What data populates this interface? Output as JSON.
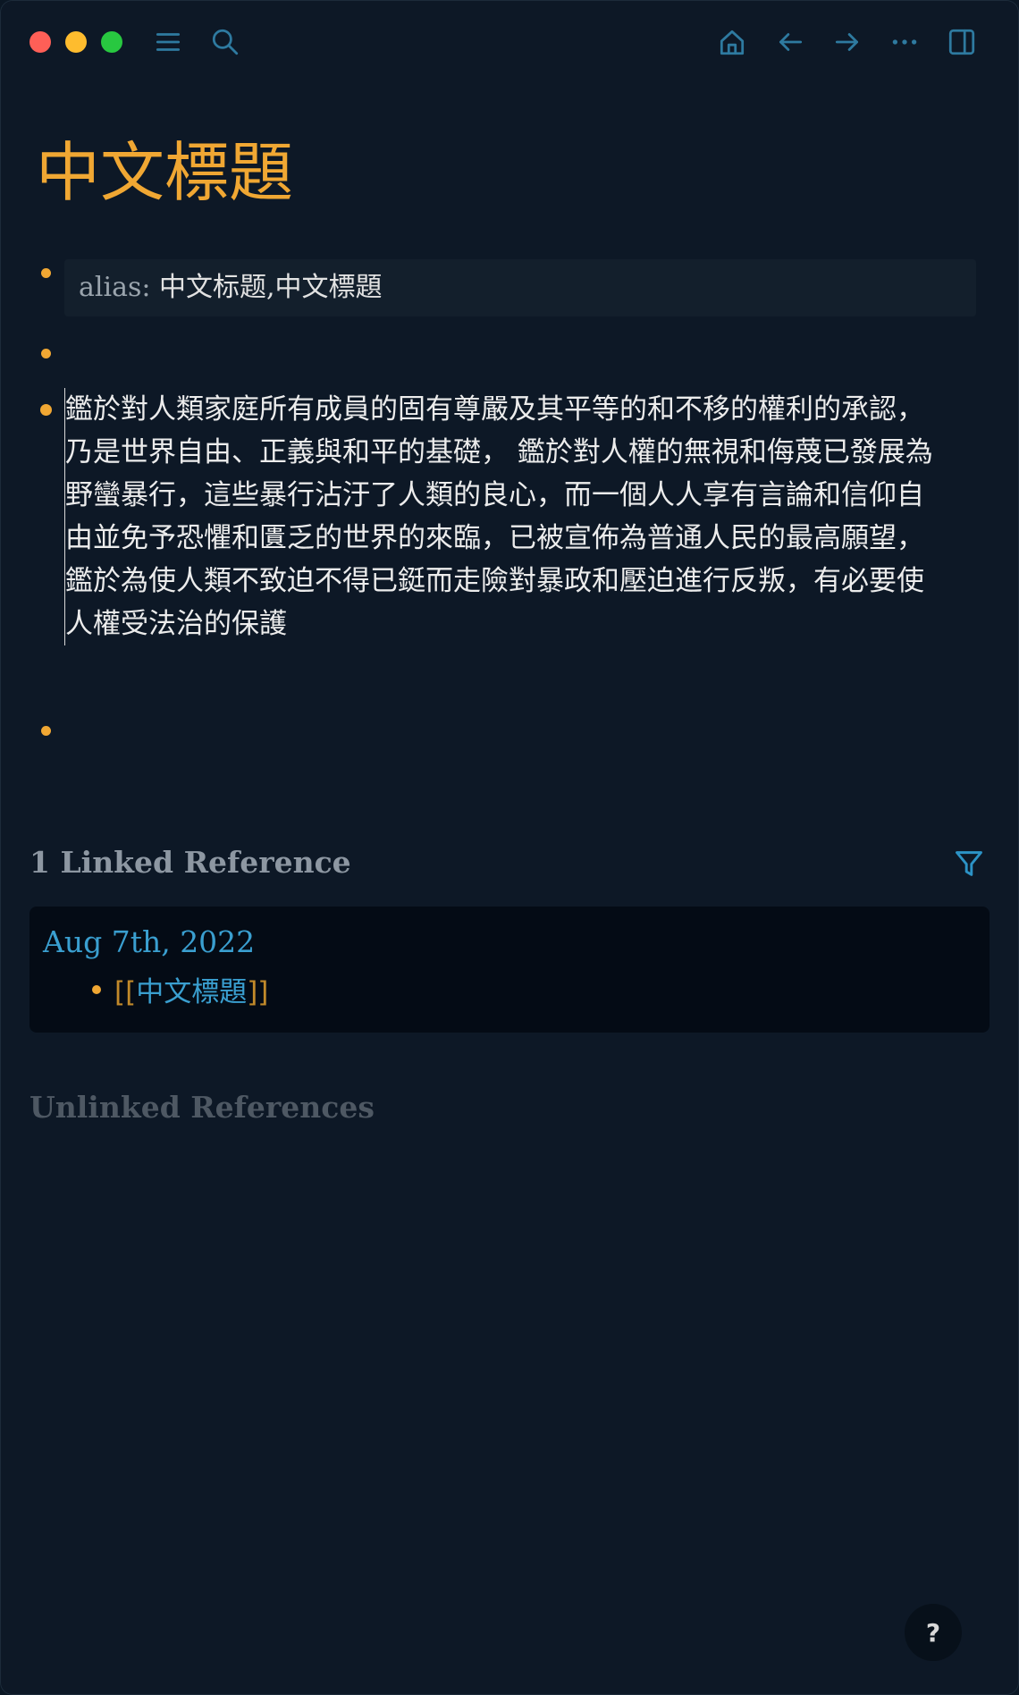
{
  "toolbar": {
    "icons": [
      "menu-icon",
      "search-icon",
      "home-icon",
      "back-arrow-icon",
      "forward-arrow-icon",
      "more-icon",
      "sidebar-toggle-icon"
    ]
  },
  "page": {
    "title": "中文標題",
    "property": {
      "key": "alias:",
      "value": " 中文标题,中文標題"
    },
    "block_text": "鑑於對人類家庭所有成員的固有尊嚴及其平等的和不移的權利的承認，\n乃是世界自由、正義與和平的基礎， 鑑於對人權的無視和侮蔑已發展為\n野蠻暴行，這些暴行沾汙了人類的良心，而一個人人享有言論和信仰自\n由並免予恐懼和匱乏的世界的來臨，已被宣佈為普通人民的最高願望，\n鑑於為使人類不致迫不得已鋌而走險對暴政和壓迫進行反叛，有必要使\n人權受法治的保護"
  },
  "references": {
    "linked_header": "1 Linked Reference",
    "linked": [
      {
        "date": "Aug 7th, 2022",
        "open_bracket": "[[",
        "link_text": "中文標題",
        "close_bracket": "]]"
      }
    ],
    "unlinked_header": "Unlinked References"
  },
  "help": {
    "label": "?"
  },
  "colors": {
    "accent_orange": "#f0a733",
    "link_blue": "#3a9fd0",
    "background": "#0d1826",
    "icon_blue": "#2e7aa0"
  }
}
